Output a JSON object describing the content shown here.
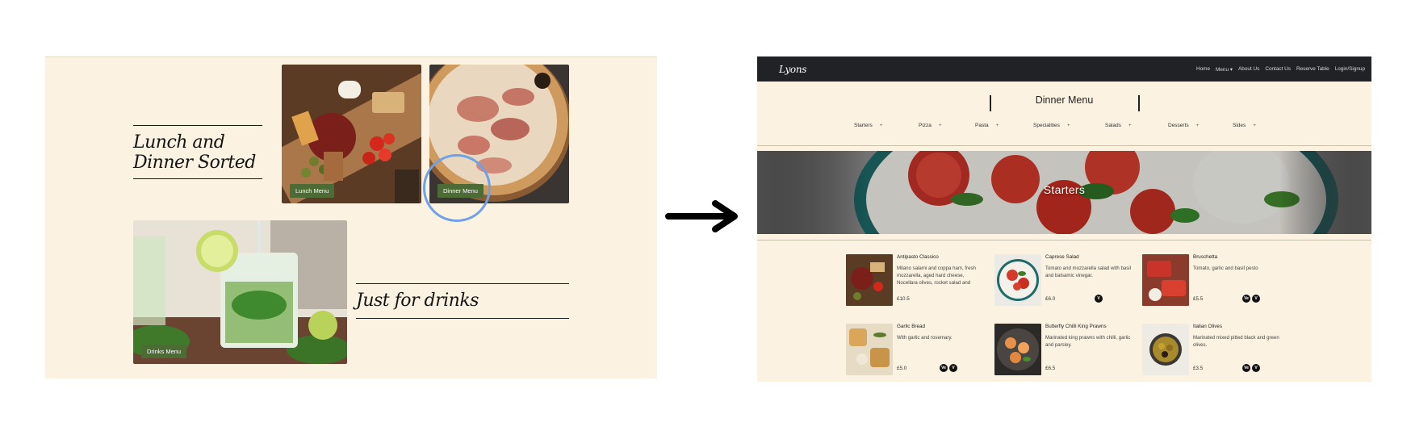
{
  "left": {
    "heading_lunch": "Lunch and Dinner Sorted",
    "heading_drinks": "Just for drinks",
    "lunch_button": "Lunch Menu",
    "dinner_button": "Dinner Menu",
    "drinks_button": "Drinks Menu"
  },
  "right": {
    "brand": "Lyons",
    "nav": [
      "Home",
      "Menu ▾",
      "About Us",
      "Contact Us",
      "Reserve Table",
      "Login/Signup"
    ],
    "menu_title": "Dinner Menu",
    "categories": [
      "Starters",
      "Pizza",
      "Pasta",
      "Specialities",
      "Salads",
      "Desserts",
      "Sides"
    ],
    "category_marker": "+",
    "banner_title": "Starters",
    "dishes": [
      {
        "name": "Antipasto Classico",
        "desc": "Milano salami and coppa ham, fresh mozzarella, aged hard cheese, Nocellara olives, rocket salad and",
        "price": "£10.5",
        "badges": []
      },
      {
        "name": "Caprese Salad",
        "desc": "Tomato and mozzarella salad with basil and balsamic vinegar.",
        "price": "£6.0",
        "badges": [
          "V"
        ]
      },
      {
        "name": "Bruschetta",
        "desc": "Tomato, garlic and basil pesto",
        "price": "£5.5",
        "badges": [
          "Ve",
          "V"
        ]
      },
      {
        "name": "Garlic Bread",
        "desc": "With garlic and rosemary.",
        "price": "£5.0",
        "badges": [
          "Ve",
          "V"
        ]
      },
      {
        "name": "Butterfly Chilli King Prawns",
        "desc": "Marinated king prawns with chilli, garlic and parsley.",
        "price": "£6.5",
        "badges": []
      },
      {
        "name": "Italian Olives",
        "desc": "Marinated mixed pitted black and green olives.",
        "price": "£3.5",
        "badges": [
          "Ve",
          "V"
        ]
      }
    ]
  },
  "colors": {
    "panel_bg": "#fbf2e1",
    "navbar_bg": "#212226",
    "button_green": "#4c6b35",
    "highlight_ring": "#6ea1e6"
  }
}
